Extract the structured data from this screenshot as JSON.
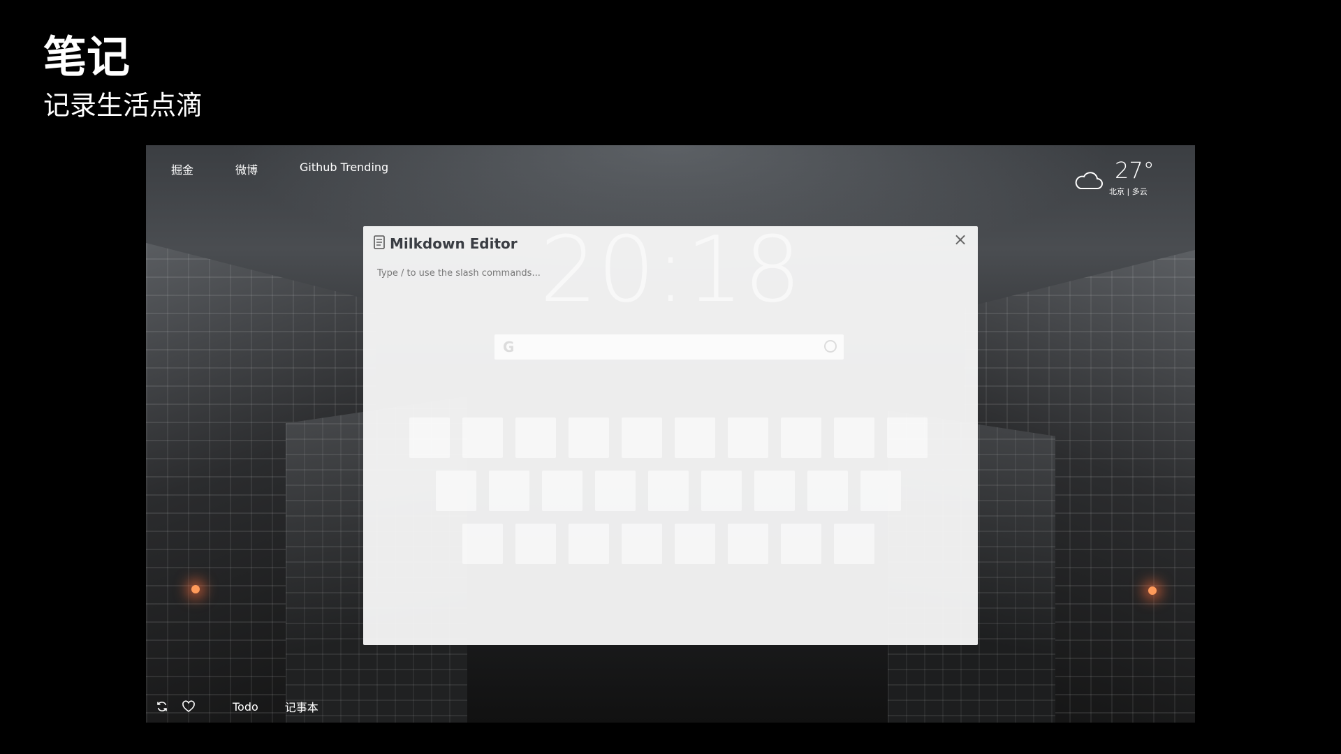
{
  "slide": {
    "title": "笔记",
    "subtitle": "记录生活点滴"
  },
  "top_nav": [
    "掘金",
    "微博",
    "Github Trending"
  ],
  "weather": {
    "icon": "cloud-icon",
    "temperature": "27°",
    "location": "北京 | 多云"
  },
  "clock": "20:18",
  "modal": {
    "title": "Milkdown Editor",
    "placeholder": "Type / to use the slash commands...",
    "close_label": "×"
  },
  "bottom_bar": {
    "icons": [
      "refresh-icon",
      "heart-icon"
    ],
    "links": [
      "Todo",
      "记事本"
    ]
  }
}
